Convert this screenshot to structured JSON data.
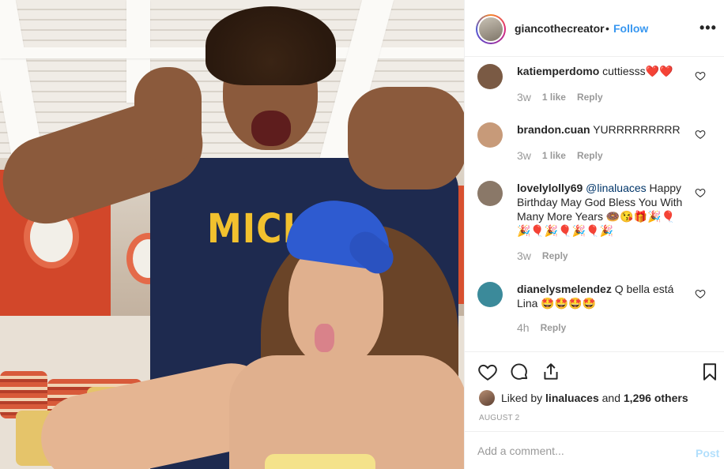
{
  "header": {
    "username": "giancothecreator",
    "separator": "•",
    "follow_label": "Follow",
    "more_glyph": "•••"
  },
  "comments": [
    {
      "user": "katiemperdomo",
      "text": "cuttiesss",
      "emoji": "❤️❤️",
      "time": "3w",
      "likes": "1 like",
      "reply": "Reply",
      "avatar_color": "#7a5a44"
    },
    {
      "user": "brandon.cuan",
      "text": "YURRRRRRRRR",
      "emoji": "",
      "time": "3w",
      "likes": "1 like",
      "reply": "Reply",
      "avatar_color": "#c79a79"
    },
    {
      "user": "lovelylolly69",
      "mention": "@linaluaces",
      "text": "Happy Birthday May God Bless You With Many More Years",
      "emoji": "🍩😘🎁🎉🎈🎉🎈🎉🎈🎉🎈🎉",
      "time": "3w",
      "likes": "",
      "reply": "Reply",
      "avatar_color": "#8a7868"
    },
    {
      "user": "dianelysmelendez",
      "text": "Q bella está Lina",
      "emoji": "🤩🤩🤩🤩",
      "time": "4h",
      "likes": "",
      "reply": "Reply",
      "avatar_color": "#3b8a9a"
    }
  ],
  "photo": {
    "shirt_text": "MICHI"
  },
  "actions": {
    "liked_prefix": "Liked by",
    "liked_user": "linaluaces",
    "liked_and": "and",
    "liked_others": "1,296 others",
    "date": "AUGUST 2"
  },
  "add_comment": {
    "placeholder": "Add a comment...",
    "post_label": "Post"
  },
  "colors": {
    "link_blue": "#3897f0",
    "post_disabled": "#b2dffc",
    "mention": "#003569",
    "muted": "#999999"
  }
}
